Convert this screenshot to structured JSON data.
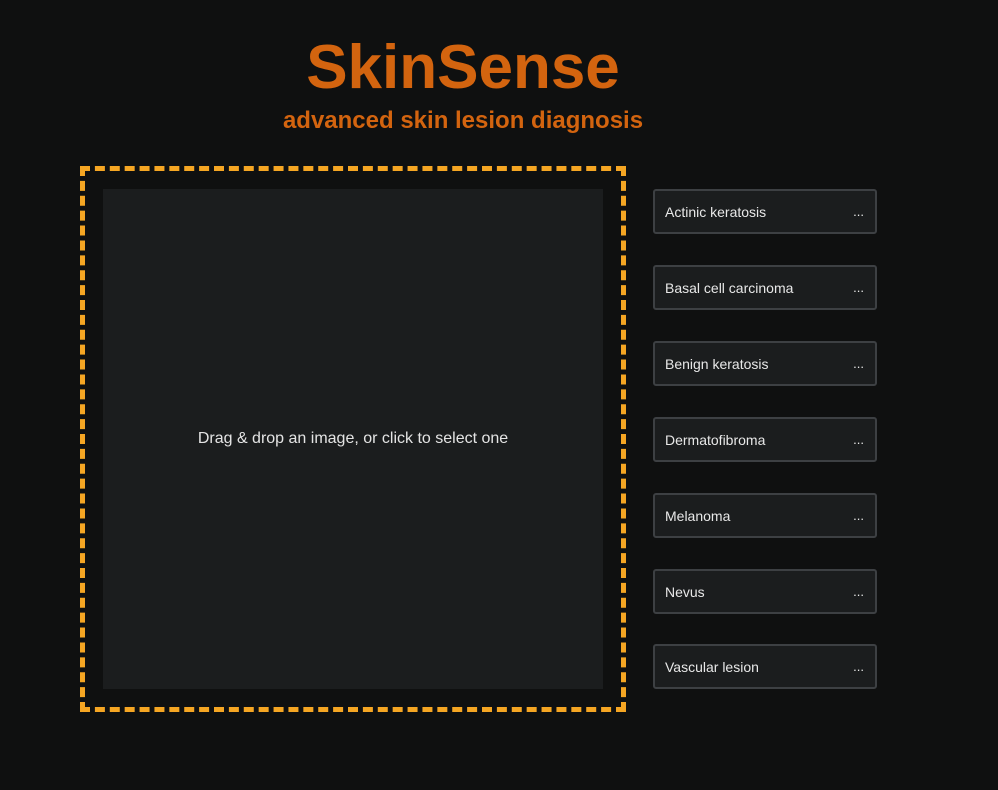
{
  "header": {
    "title": "SkinSense",
    "subtitle": "advanced skin lesion diagnosis"
  },
  "dropzone": {
    "text": "Drag & drop an image, or click to select one"
  },
  "classes": [
    {
      "label": "Actinic keratosis",
      "value": "..."
    },
    {
      "label": "Basal cell carcinoma",
      "value": "..."
    },
    {
      "label": "Benign keratosis",
      "value": "..."
    },
    {
      "label": "Dermatofibroma",
      "value": "..."
    },
    {
      "label": "Melanoma",
      "value": "..."
    },
    {
      "label": "Nevus",
      "value": "..."
    },
    {
      "label": "Vascular lesion",
      "value": "..."
    }
  ],
  "colors": {
    "accent": "#d3640f",
    "dropzone_border": "#f5a623",
    "background": "#0f1010",
    "panel": "#1b1d1e"
  }
}
